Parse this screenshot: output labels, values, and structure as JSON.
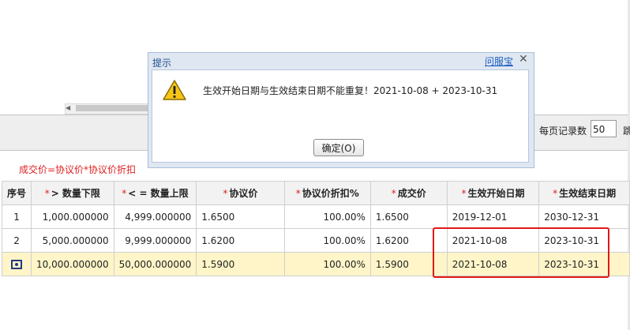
{
  "toolbar": {
    "per_page_label": "每页记录数",
    "per_page_value": "50",
    "per_page_cut_text": "跳"
  },
  "formula_note": "成交价=协议价*协议价折扣",
  "table": {
    "headers": [
      {
        "req": "",
        "label": "序号"
      },
      {
        "req": "*",
        "label": "> 数量下限"
      },
      {
        "req": "*",
        "label": "< = 数量上限"
      },
      {
        "req": "*",
        "label": "协议价"
      },
      {
        "req": "*",
        "label": "协议价折扣%"
      },
      {
        "req": "*",
        "label": "成交价"
      },
      {
        "req": "*",
        "label": "生效开始日期"
      },
      {
        "req": "*",
        "label": "生效结束日期"
      }
    ],
    "rows": [
      {
        "idx": "1",
        "min": "1,000.000000",
        "max": "4,999.000000",
        "price": "1.6500",
        "discount": "100.00%",
        "deal": "1.6500",
        "start": "2019-12-01",
        "end": "2030-12-31"
      },
      {
        "idx": "2",
        "min": "5,000.000000",
        "max": "9,999.000000",
        "price": "1.6200",
        "discount": "100.00%",
        "deal": "1.6200",
        "start": "2021-10-08",
        "end": "2023-10-31"
      },
      {
        "idx": "",
        "min": "10,000.000000",
        "max": "50,000.000000",
        "price": "1.5900",
        "discount": "100.00%",
        "deal": "1.5900",
        "start": "2021-10-08",
        "end": "2023-10-31"
      }
    ]
  },
  "dialog": {
    "title": "提示",
    "help_link": "问服宝",
    "close_glyph": "✕",
    "message": "生效开始日期与生效结束日期不能重复！2021-10-08 + 2023-10-31",
    "ok_label": "确定(O)",
    "icon": "warning-icon"
  },
  "colors": {
    "required_mark": "#e02020",
    "selected_row": "#fff5c8",
    "highlight_box": "#e01818",
    "dialog_title": "#1f4e8a"
  }
}
